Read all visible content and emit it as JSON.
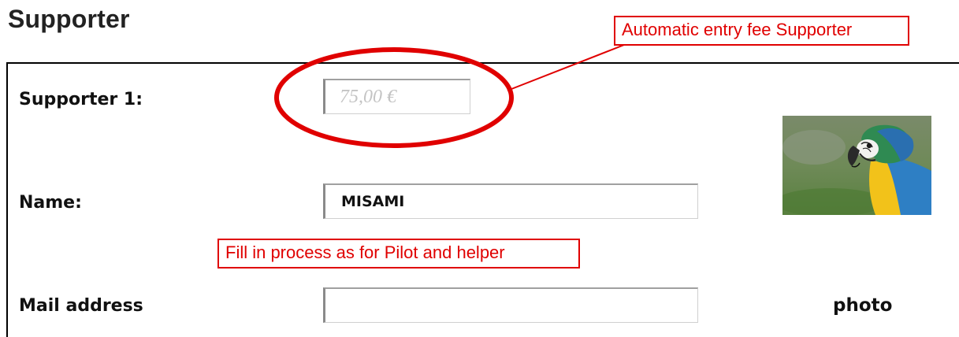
{
  "page": {
    "title": "Supporter"
  },
  "fields": {
    "supporter1": {
      "label": "Supporter 1:",
      "value": "75,00 €"
    },
    "name": {
      "label": "Name:",
      "value": "MISAMI"
    },
    "mail": {
      "label": "Mail address",
      "value": ""
    }
  },
  "annotations": {
    "fee_note": "Automatic entry fee Supporter",
    "fill_note": "Fill in process as for Pilot and helper",
    "color": "#e00000"
  },
  "photo": {
    "label": "photo",
    "subject": "blue-and-yellow macaw parrot"
  }
}
